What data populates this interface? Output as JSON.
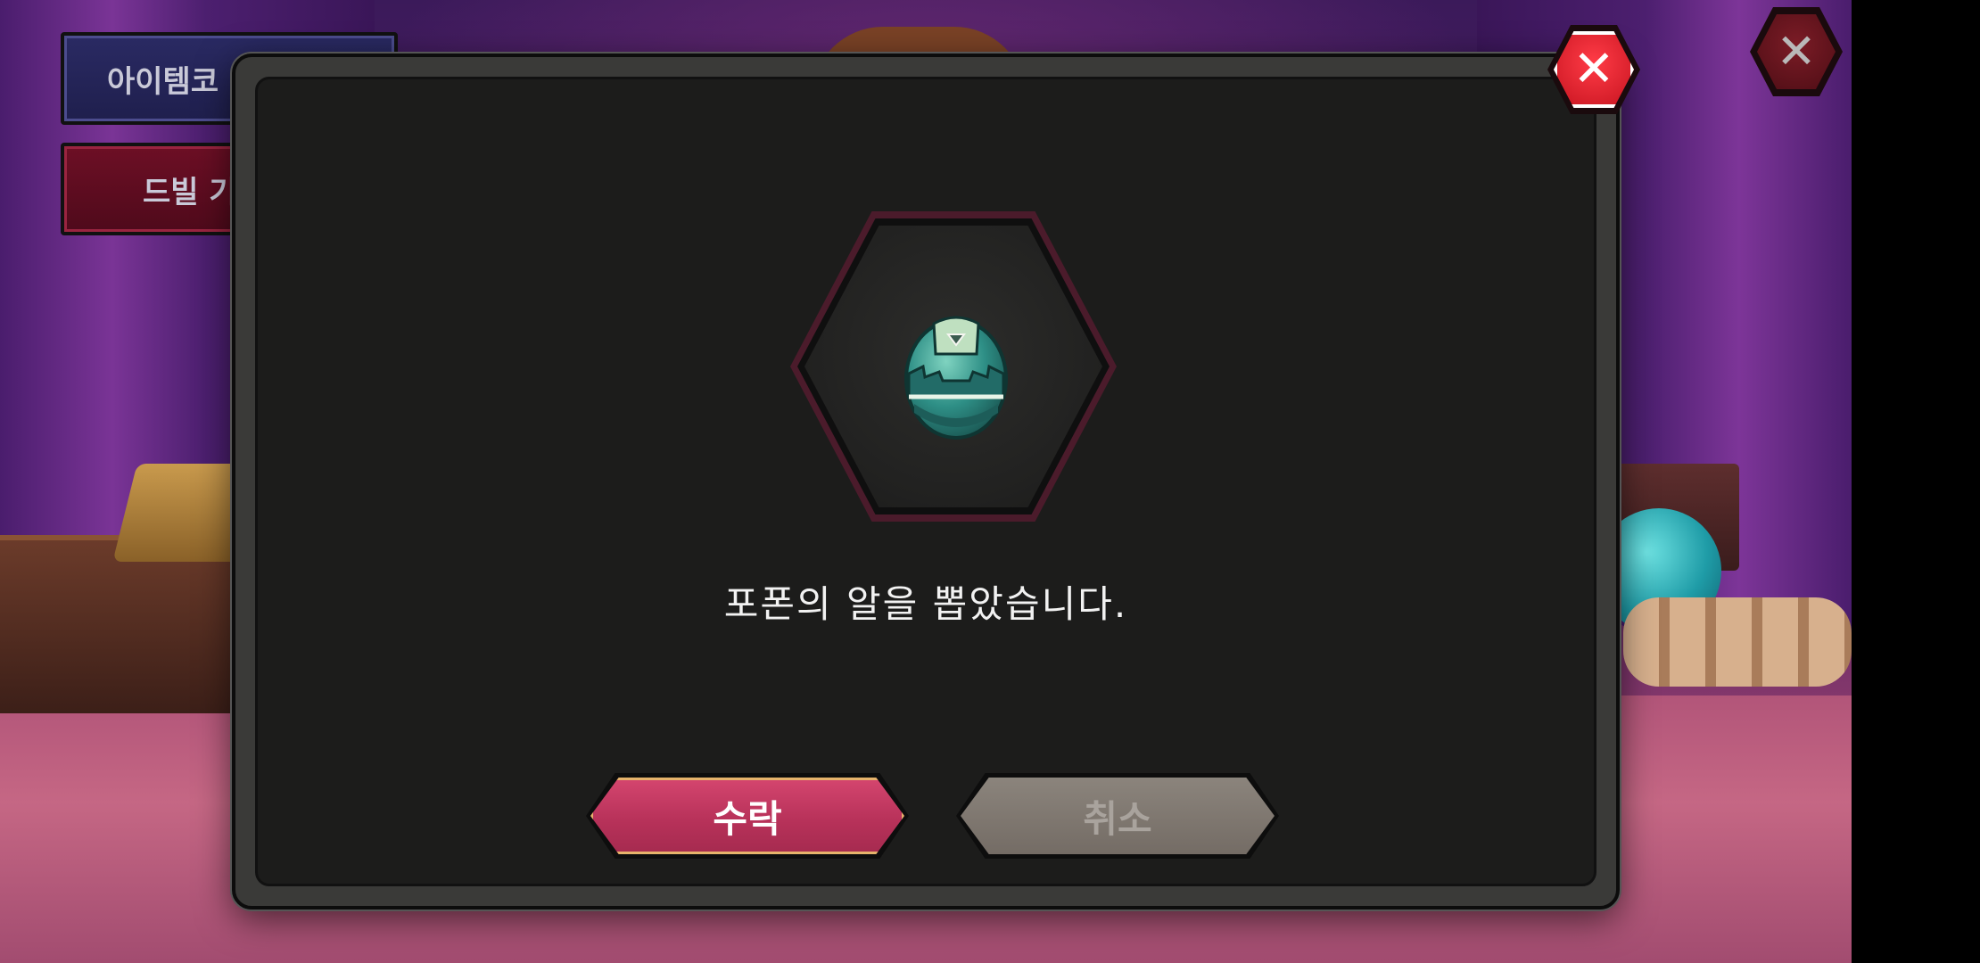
{
  "side_menu": {
    "item_code_label": "아이템코",
    "drill_label": "드빌 기"
  },
  "dialog": {
    "item_icon": "egg-icon",
    "message": "포폰의 알을 뽑았습니다.",
    "accept_label": "수락",
    "cancel_label": "취소",
    "close_icon": "close-icon"
  },
  "colors": {
    "accept": "#b8325a",
    "cancel": "#746c65",
    "close": "#e01f2b",
    "dialog_bg": "#1c1c1b"
  }
}
